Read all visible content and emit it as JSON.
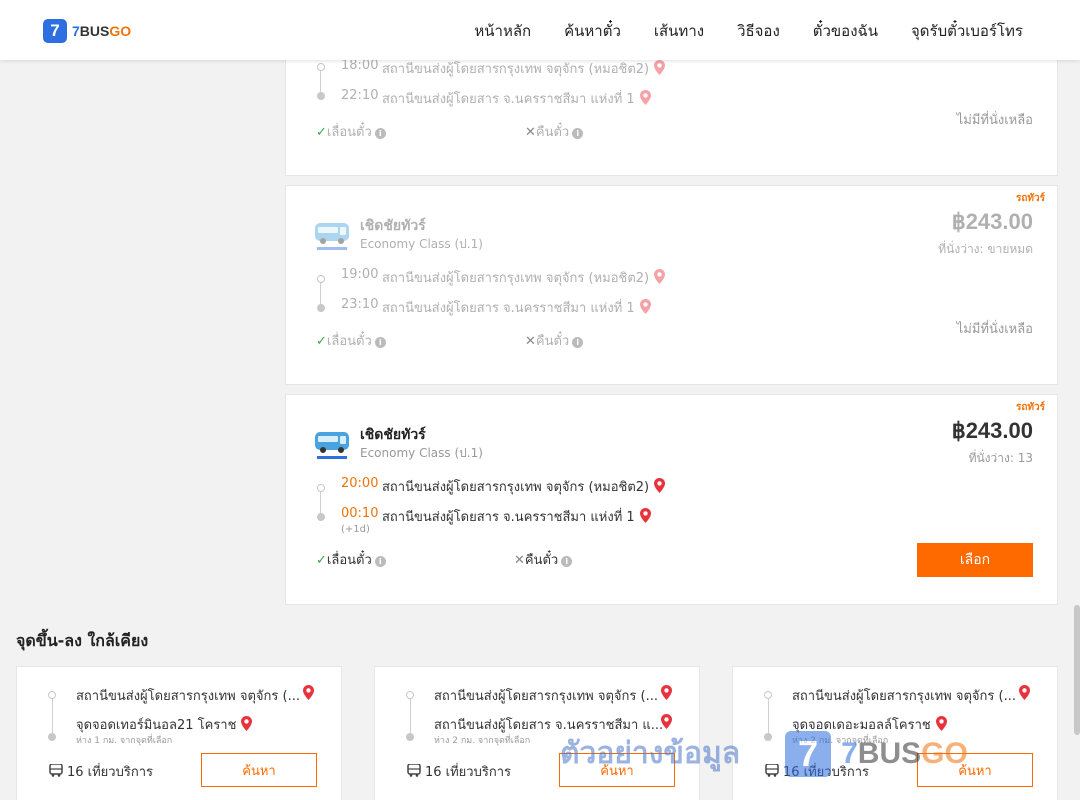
{
  "header": {
    "logo_mark": "7",
    "logo_num": "7",
    "logo_bus": "BUS",
    "logo_go": "GO",
    "nav": [
      "หน้าหลัก",
      "ค้นหาตั๋ว",
      "เส้นทาง",
      "วิธีจอง",
      "ตั๋วของฉัน",
      "จุดรับตั๋วเบอร์โทร"
    ]
  },
  "trips": [
    {
      "dep_time": "18:00",
      "dep_station": "สถานีขนส่งผู้โดยสารกรุงเทพ จตุจักร (หมอชิต2)",
      "arr_time": "22:10",
      "arr_station": "สถานีขนส่งผู้โดยสาร จ.นครราชสีมา แห่งที่ 1",
      "reschedule": "เลื่อนตั๋ว",
      "refund": "คืนตั๋ว",
      "status": "ไม่มีที่นั่งเหลือ"
    },
    {
      "tag": "รถทัวร์",
      "operator": "เชิดชัยทัวร์",
      "class": "Economy Class (ป.1)",
      "price": "฿243.00",
      "seats": "ที่นั่งว่าง: ขายหมด",
      "dep_time": "19:00",
      "dep_station": "สถานีขนส่งผู้โดยสารกรุงเทพ จตุจักร (หมอชิต2)",
      "arr_time": "23:10",
      "arr_station": "สถานีขนส่งผู้โดยสาร จ.นครราชสีมา แห่งที่ 1",
      "reschedule": "เลื่อนตั๋ว",
      "refund": "คืนตั๋ว",
      "status": "ไม่มีที่นั่งเหลือ"
    },
    {
      "tag": "รถทัวร์",
      "operator": "เชิดชัยทัวร์",
      "class": "Economy Class (ป.1)",
      "price": "฿243.00",
      "seats": "ที่นั่งว่าง: 13",
      "dep_time": "20:00",
      "dep_station": "สถานีขนส่งผู้โดยสารกรุงเทพ จตุจักร (หมอชิต2)",
      "arr_time": "00:10",
      "arr_station": "สถานีขนส่งผู้โดยสาร จ.นครราชสีมา แห่งที่ 1",
      "next_day": "(+1d)",
      "reschedule": "เลื่อนตั๋ว",
      "refund": "คืนตั๋ว",
      "select_label": "เลือก"
    }
  ],
  "nearby": {
    "title": "จุดขึ้น-ลง ใกล้เคียง",
    "items": [
      {
        "from": "สถานีขนส่งผู้โดยสารกรุงเทพ จตุจักร (...",
        "to": "จุดจอดเทอร์มินอล21 โคราช",
        "distance": "ห่าง 1 กม. จากจุดที่เลือก",
        "trips": "16 เที่ยวบริการ",
        "search_label": "ค้นหา"
      },
      {
        "from": "สถานีขนส่งผู้โดยสารกรุงเทพ จตุจักร (...",
        "to": "สถานีขนส่งผู้โดยสาร จ.นครราชสีมา แ...",
        "distance": "ห่าง 2 กม. จากจุดที่เลือก",
        "trips": "16 เที่ยวบริการ",
        "search_label": "ค้นหา"
      },
      {
        "from": "สถานีขนส่งผู้โดยสารกรุงเทพ จตุจักร (...",
        "to": "จุดจอดเดอะมอลล์โคราช",
        "distance": "ห่าง 2 กม. จากจุดที่เลือก",
        "trips": "16 เที่ยวบริการ",
        "search_label": "ค้นหา"
      }
    ]
  },
  "watermark": {
    "text": "ตัวอย่างข้อมูล",
    "mark": "7",
    "name_num": "7",
    "name_bus": "BUS",
    "name_go": "GO"
  },
  "colors": {
    "accent": "#ff6a00",
    "brand_blue": "#2d6ee0",
    "pin_red": "#e8323c",
    "check_green": "#3aa54a"
  }
}
